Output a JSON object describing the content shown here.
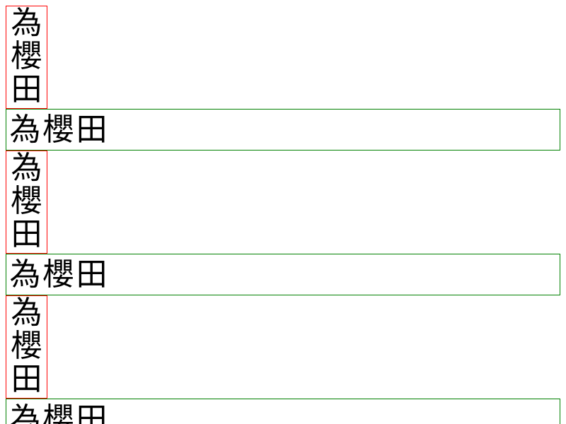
{
  "rows": [
    {
      "vertical": [
        "為",
        "櫻",
        "田"
      ],
      "horizontal": [
        "為",
        "櫻",
        "田"
      ]
    },
    {
      "vertical": [
        "為",
        "櫻",
        "田"
      ],
      "horizontal": [
        "為",
        "櫻",
        "田"
      ]
    },
    {
      "vertical": [
        "為",
        "櫻",
        "田"
      ],
      "horizontal": [
        "為",
        "櫻",
        "田"
      ]
    }
  ],
  "colors": {
    "vertical_border": "#ff0000",
    "horizontal_border": "#008000",
    "text": "#000000",
    "background": "#ffffff"
  }
}
